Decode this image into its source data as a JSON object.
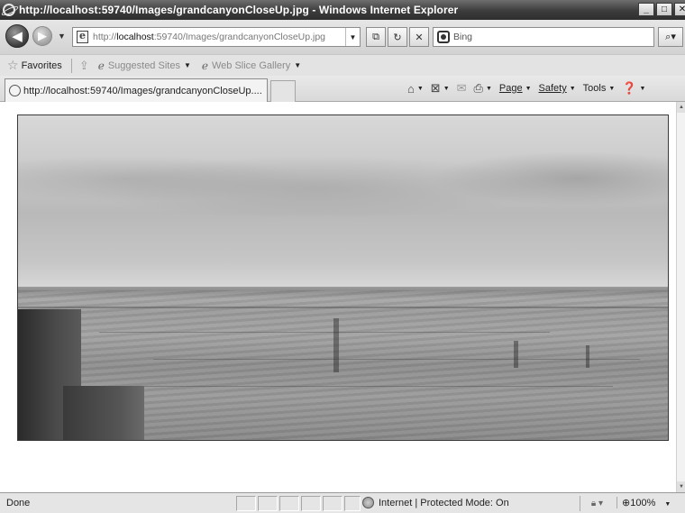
{
  "window": {
    "title": "http://localhost:59740/Images/grandcanyonCloseUp.jpg - Windows Internet Explorer",
    "minimize": "_",
    "maximize": "□",
    "close": "✕"
  },
  "nav": {
    "back_glyph": "◀",
    "forward_glyph": "▶",
    "address_prefix": "http://",
    "address_host": "localhost",
    "address_path": ":59740/Images/grandcanyonCloseUp.jpg",
    "search_placeholder": "Bing",
    "icons": [
      "back-icon",
      "forward-icon",
      "compatibility-icon",
      "refresh-icon",
      "stop-icon",
      "bing-icon",
      "search-icon"
    ]
  },
  "favorites_bar": {
    "favorites_label": "Favorites",
    "items": [
      {
        "label": "Suggested Sites",
        "icon": "ie-icon"
      },
      {
        "label": "Web Slice Gallery",
        "icon": "web-slice-icon"
      }
    ]
  },
  "tab": {
    "label": "http://localhost:59740/Images/grandcanyonCloseUp...."
  },
  "command_bar": {
    "page_label": "Page",
    "safety_label": "Safety",
    "tools_label": "Tools",
    "icons": [
      "home-icon",
      "feeds-icon",
      "read-mail-icon",
      "print-icon",
      "help-icon"
    ]
  },
  "content": {
    "image_subject": "grand-canyon-photo"
  },
  "status_bar": {
    "status_text": "Done",
    "zone_text": "Internet | Protected Mode: On",
    "zoom_text": "100%"
  }
}
